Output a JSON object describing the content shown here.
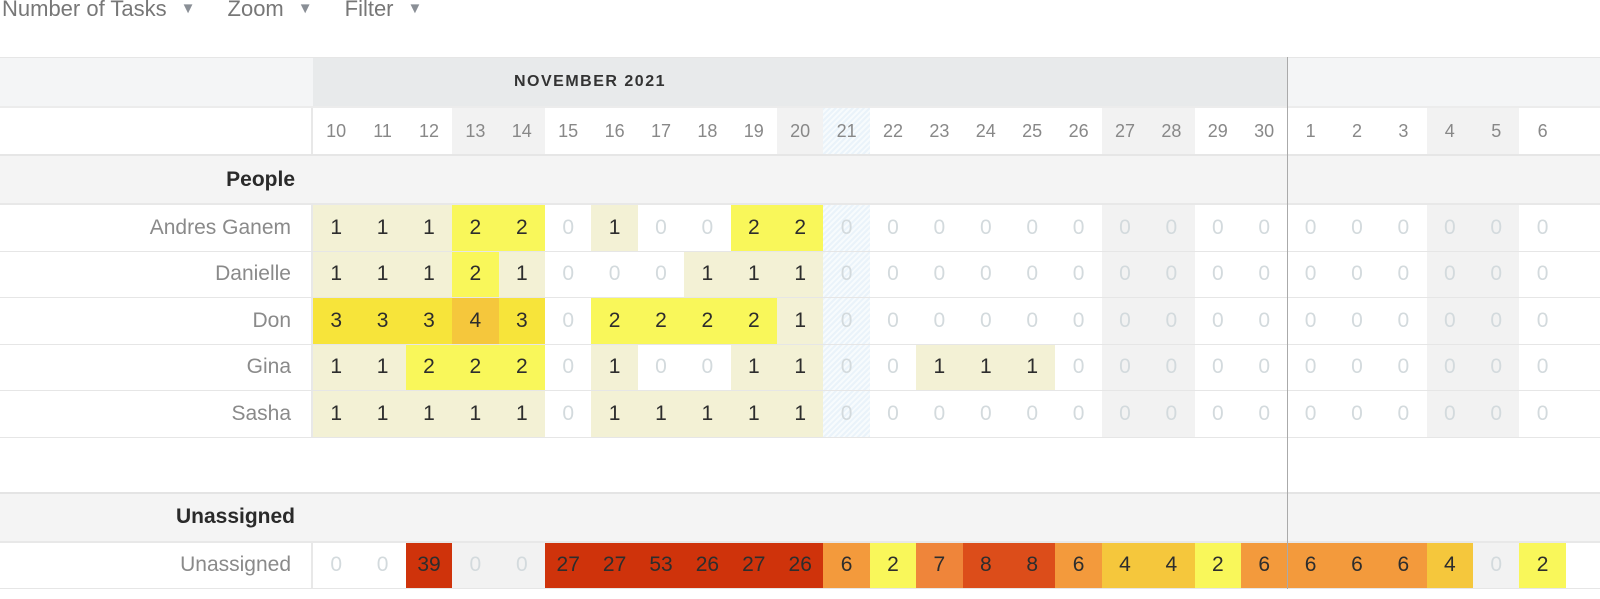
{
  "toolbar": {
    "items": [
      {
        "label": "Number of Tasks",
        "icon": "caret-down-icon"
      },
      {
        "label": "Zoom",
        "icon": "caret-down-icon"
      },
      {
        "label": "Filter",
        "icon": "caret-down-icon"
      }
    ],
    "caret": "▼"
  },
  "months": [
    {
      "label": "NOVEMBER 2021"
    },
    {
      "label": ""
    }
  ],
  "days": [
    {
      "d": "10",
      "type": ""
    },
    {
      "d": "11",
      "type": ""
    },
    {
      "d": "12",
      "type": ""
    },
    {
      "d": "13",
      "type": "wknd"
    },
    {
      "d": "14",
      "type": "wknd"
    },
    {
      "d": "15",
      "type": ""
    },
    {
      "d": "16",
      "type": ""
    },
    {
      "d": "17",
      "type": ""
    },
    {
      "d": "18",
      "type": ""
    },
    {
      "d": "19",
      "type": ""
    },
    {
      "d": "20",
      "type": "wknd"
    },
    {
      "d": "21",
      "type": "today"
    },
    {
      "d": "22",
      "type": ""
    },
    {
      "d": "23",
      "type": ""
    },
    {
      "d": "24",
      "type": ""
    },
    {
      "d": "25",
      "type": ""
    },
    {
      "d": "26",
      "type": ""
    },
    {
      "d": "27",
      "type": "wknd"
    },
    {
      "d": "28",
      "type": "wknd"
    },
    {
      "d": "29",
      "type": ""
    },
    {
      "d": "30",
      "type": ""
    },
    {
      "d": "1",
      "type": ""
    },
    {
      "d": "2",
      "type": ""
    },
    {
      "d": "3",
      "type": ""
    },
    {
      "d": "4",
      "type": "wknd"
    },
    {
      "d": "5",
      "type": "wknd"
    },
    {
      "d": "6",
      "type": ""
    }
  ],
  "colors": {
    "level1": "#f3f1d5",
    "level2": "#f9f75a",
    "level3": "#f7e43a",
    "level4": "#f5c73c",
    "level5": "#f6cd40",
    "level6": "#f39a3c",
    "level7": "#ef853a",
    "level8": "#dc4d1a",
    "level_high": "#cf330b"
  },
  "groups": [
    {
      "label": "People",
      "rows": [
        {
          "name": "Andres Ganem",
          "values": [
            1,
            1,
            1,
            2,
            2,
            0,
            1,
            0,
            0,
            2,
            2,
            0,
            0,
            0,
            0,
            0,
            0,
            0,
            0,
            0,
            0,
            0,
            0,
            0,
            0,
            0,
            0
          ]
        },
        {
          "name": "Danielle",
          "values": [
            1,
            1,
            1,
            2,
            1,
            0,
            0,
            0,
            1,
            1,
            1,
            0,
            0,
            0,
            0,
            0,
            0,
            0,
            0,
            0,
            0,
            0,
            0,
            0,
            0,
            0,
            0
          ]
        },
        {
          "name": "Don",
          "values": [
            3,
            3,
            3,
            4,
            3,
            0,
            2,
            2,
            2,
            2,
            1,
            0,
            0,
            0,
            0,
            0,
            0,
            0,
            0,
            0,
            0,
            0,
            0,
            0,
            0,
            0,
            0
          ]
        },
        {
          "name": "Gina",
          "values": [
            1,
            1,
            2,
            2,
            2,
            0,
            1,
            0,
            0,
            1,
            1,
            0,
            0,
            1,
            1,
            1,
            0,
            0,
            0,
            0,
            0,
            0,
            0,
            0,
            0,
            0,
            0
          ]
        },
        {
          "name": "Sasha",
          "values": [
            1,
            1,
            1,
            1,
            1,
            0,
            1,
            1,
            1,
            1,
            1,
            0,
            0,
            0,
            0,
            0,
            0,
            0,
            0,
            0,
            0,
            0,
            0,
            0,
            0,
            0,
            0
          ]
        }
      ]
    },
    {
      "label": "Unassigned",
      "rows": [
        {
          "name": "Unassigned",
          "values": [
            0,
            0,
            39,
            0,
            0,
            27,
            27,
            53,
            26,
            27,
            26,
            6,
            2,
            7,
            8,
            8,
            6,
            4,
            4,
            2,
            6,
            6,
            6,
            6,
            4,
            0,
            2
          ]
        }
      ]
    }
  ]
}
